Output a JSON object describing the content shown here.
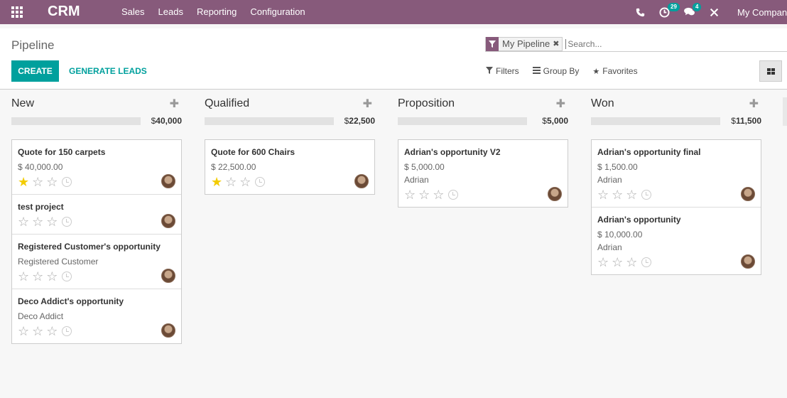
{
  "navbar": {
    "brand": "CRM",
    "menu": [
      "Sales",
      "Leads",
      "Reporting",
      "Configuration"
    ],
    "activity_count": "29",
    "message_count": "4",
    "company": "My Company"
  },
  "control": {
    "breadcrumb": "Pipeline",
    "facet_label": "My Pipeline",
    "search_placeholder": "Search...",
    "create_label": "CREATE",
    "generate_label": "GENERATE LEADS",
    "filters_label": "Filters",
    "groupby_label": "Group By",
    "favorites_label": "Favorites"
  },
  "columns": [
    {
      "title": "New",
      "total": "40,000",
      "cards": [
        {
          "title": "Quote for 150 carpets",
          "lines": [
            "$ 40,000.00"
          ],
          "stars": 1
        },
        {
          "title": "test project",
          "lines": [],
          "stars": 0
        },
        {
          "title": "Registered Customer's opportunity",
          "lines": [
            "Registered Customer"
          ],
          "stars": 0
        },
        {
          "title": "Deco Addict's opportunity",
          "lines": [
            "Deco Addict"
          ],
          "stars": 0
        }
      ]
    },
    {
      "title": "Qualified",
      "total": "22,500",
      "cards": [
        {
          "title": "Quote for 600 Chairs",
          "lines": [
            "$ 22,500.00"
          ],
          "stars": 1
        }
      ]
    },
    {
      "title": "Proposition",
      "total": "5,000",
      "cards": [
        {
          "title": "Adrian's opportunity V2",
          "lines": [
            "$ 5,000.00",
            "Adrian"
          ],
          "stars": 0
        }
      ]
    },
    {
      "title": "Won",
      "total": "11,500",
      "cards": [
        {
          "title": "Adrian's opportunity final",
          "lines": [
            "$ 1,500.00",
            "Adrian"
          ],
          "stars": 0
        },
        {
          "title": "Adrian's opportunity",
          "lines": [
            "$ 10,000.00",
            "Adrian"
          ],
          "stars": 0
        }
      ]
    }
  ],
  "currency_symbol": "$",
  "colors": {
    "brand": "#875a7b",
    "accent": "#00a09d",
    "star_on": "#f3cc00"
  }
}
